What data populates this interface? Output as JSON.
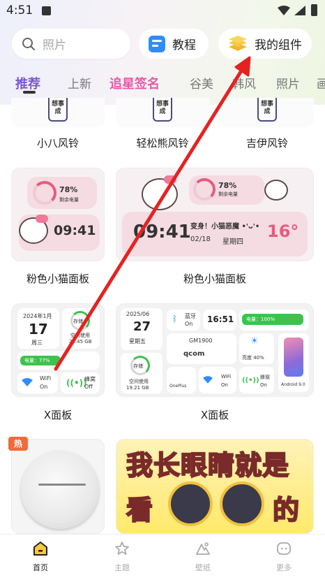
{
  "status_bar": {
    "time": "4:51"
  },
  "header": {
    "search_placeholder": "照片",
    "tutorial_label": "教程",
    "widgets_label": "我的组件"
  },
  "tabs": [
    "推荐",
    "上新",
    "追星签名",
    "谷美",
    "韩风",
    "照片",
    "画"
  ],
  "cards": {
    "row1": [
      "小八风铃",
      "轻松熊风铃",
      "吉伊风铃"
    ],
    "bell_text": "想事成",
    "kitty_small_label": "粉色小猫面板",
    "kitty_large_label": "粉色小猫面板",
    "x_small_label": "X面板",
    "x_large_label": "X面板"
  },
  "kitty_small": {
    "battery_pct": "78%",
    "battery_label": "剩余电量",
    "time": "09:41"
  },
  "kitty_large": {
    "battery_pct": "78%",
    "battery_label": "剩余电量",
    "time": "09:41",
    "title": "变身！小猫恶魔 •'ᴗ'•",
    "date": "02/18",
    "weekday": "星期四",
    "temp": "16°"
  },
  "x_small": {
    "date": "2024年1月",
    "day": "17",
    "weekday": "周三",
    "storage_label": "存储",
    "storage_text": "空间使用",
    "storage_size": "29.45 GB",
    "battery": "电量：77%",
    "wifi": "WiFi",
    "wifi_state": "On",
    "data": "蜂窝",
    "data_state": "Off"
  },
  "x_large": {
    "date": "2025/06",
    "day": "27",
    "weekday": "星期五",
    "bt": "蓝牙",
    "bt_state": "On",
    "clock": "16:51",
    "battery": "电量：100%",
    "model": "GM1900",
    "chip": "qcom",
    "storage_label": "存储",
    "storage_text": "空间使用",
    "storage_size": "19.21 GB",
    "brand": "OnePlus",
    "wifi": "WiFi",
    "wifi_state": "On",
    "cell": "蜂窝",
    "cell_state": "On",
    "brightness": "亮度 40%",
    "android": "Android 9.0"
  },
  "hot_tag": "热",
  "poster": {
    "line1": "我长眼睛就是",
    "line2_left": "看",
    "line2_right": "的"
  },
  "bottom_nav": [
    "首页",
    "主题",
    "壁纸",
    "更多"
  ]
}
